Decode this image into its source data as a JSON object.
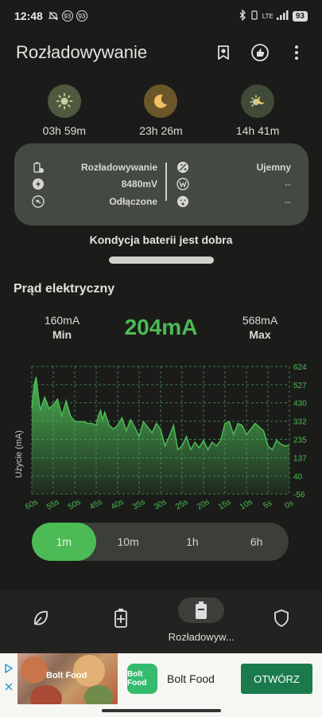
{
  "status_bar": {
    "time": "12:48",
    "notification_badges": [
      "93",
      "93"
    ],
    "network": "LTE",
    "battery_level": "93"
  },
  "header": {
    "title": "Rozładowywanie",
    "icons": [
      "award-icon",
      "thumbs-up-icon",
      "more-vert-icon"
    ]
  },
  "time_stats": [
    {
      "icon": "sun-icon",
      "value": "03h 59m"
    },
    {
      "icon": "moon-icon",
      "value": "23h 26m"
    },
    {
      "icon": "sun-moon-icon",
      "value": "14h 41m"
    }
  ],
  "info_card": {
    "left": [
      {
        "icon": "battery-status-icon",
        "value": "Rozładowywanie"
      },
      {
        "icon": "bolt-icon",
        "value": "8480mV"
      },
      {
        "icon": "plug-icon",
        "value": "Odłączone"
      }
    ],
    "right": [
      {
        "icon": "charge-type-icon",
        "value": "Ujemny"
      },
      {
        "icon": "watt-icon",
        "value": "--"
      },
      {
        "icon": "temperature-face-icon",
        "value": "--"
      }
    ]
  },
  "condition_text": "Kondycja baterii jest dobra",
  "section_title": "Prąd elektryczny",
  "current_stats": {
    "min_value": "160mA",
    "min_label": "Min",
    "current_value": "204mA",
    "max_value": "568mA",
    "max_label": "Max"
  },
  "chart_data": {
    "type": "area",
    "ylabel": "Użycie (mA)",
    "x_tick_labels": [
      "60s",
      "55s",
      "50s",
      "45s",
      "40s",
      "35s",
      "30s",
      "25s",
      "20s",
      "15s",
      "10s",
      "5s",
      "0s"
    ],
    "y_tick_labels": [
      "624",
      "527",
      "430",
      "332",
      "235",
      "137",
      "40",
      "-56"
    ],
    "ylim": [
      -56,
      624
    ],
    "x_seconds_ago": [
      60,
      59.5,
      59,
      58.5,
      58,
      57,
      56,
      55,
      54,
      53,
      52,
      51,
      50,
      49,
      48,
      47,
      46,
      45,
      44.5,
      44,
      43.5,
      43,
      42,
      41,
      40,
      39,
      38,
      37,
      36,
      35,
      34,
      33,
      32,
      31,
      30,
      29,
      28,
      27,
      26,
      25,
      24,
      23,
      22,
      21,
      20,
      19,
      18,
      17,
      16,
      15,
      14,
      13,
      12,
      11,
      10,
      9,
      8,
      7,
      6,
      5,
      4,
      3,
      2,
      1,
      0
    ],
    "values": [
      400,
      520,
      568,
      470,
      390,
      460,
      400,
      420,
      450,
      360,
      440,
      360,
      330,
      330,
      330,
      320,
      320,
      310,
      360,
      390,
      340,
      380,
      310,
      290,
      310,
      350,
      280,
      340,
      300,
      250,
      330,
      300,
      270,
      320,
      290,
      200,
      250,
      310,
      180,
      200,
      250,
      180,
      220,
      190,
      230,
      180,
      220,
      200,
      230,
      320,
      330,
      260,
      320,
      310,
      260,
      290,
      320,
      300,
      280,
      200,
      180,
      230,
      210,
      200,
      204
    ],
    "series_color": "#4cbb55",
    "grid": true
  },
  "range_tabs": {
    "items": [
      "1m",
      "10m",
      "1h",
      "6h"
    ],
    "active": "1m"
  },
  "bottom_nav": {
    "items": [
      {
        "icon": "leaf-icon",
        "label": ""
      },
      {
        "icon": "battery-plus-icon",
        "label": ""
      },
      {
        "icon": "battery-icon",
        "label": "Rozładowyw..."
      },
      {
        "icon": "shield-icon",
        "label": ""
      }
    ],
    "active_index": 2
  },
  "ad": {
    "image_brand": "Bolt Food",
    "logo_text": "Bolt Food",
    "name": "Bolt Food",
    "cta": "OTWÓRZ"
  },
  "colors": {
    "background": "#1b1c1a",
    "accent": "#4cbb55",
    "card": "#454943"
  }
}
